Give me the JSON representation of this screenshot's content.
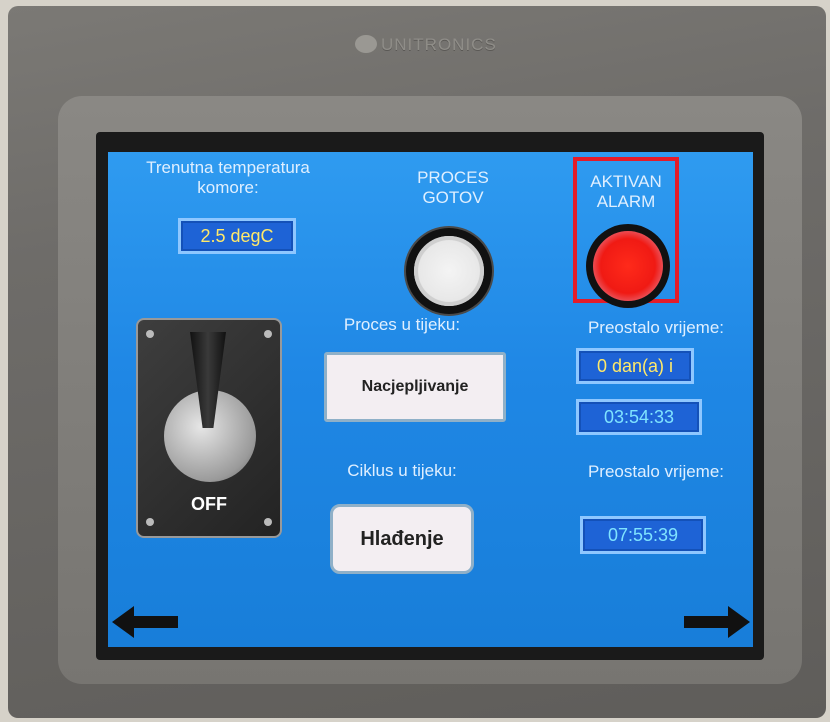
{
  "device": {
    "brand": "UNITRONICS"
  },
  "hmi": {
    "temp_label": "Trenutna temperatura komore:",
    "temp_value": "2.5 degC",
    "proces_gotov_label": "PROCES GOTOV",
    "alarm_label": "AKTIVAN ALARM",
    "process_running_label": "Proces u tijeku:",
    "process_running_value": "Nacjepljivanje",
    "cycle_running_label": "Ciklus u tijeku:",
    "cycle_running_value": "Hlađenje",
    "remaining_label_1": "Preostalo vrijeme:",
    "remaining_days": "0 dan(a) i",
    "remaining_time_1": "03:54:33",
    "remaining_label_2": "Preostalo vrijeme:",
    "remaining_time_2": "07:55:39",
    "switch_state": "OFF"
  },
  "colors": {
    "screen_blue": "#2f9bf0",
    "alarm_red": "#e31c2a",
    "field_text_yellow": "#ffe96a",
    "field_text_cyan": "#7fe3ff"
  },
  "icons": {
    "prev": "arrow-left-icon",
    "next": "arrow-right-icon",
    "switch": "toggle-switch-icon"
  }
}
